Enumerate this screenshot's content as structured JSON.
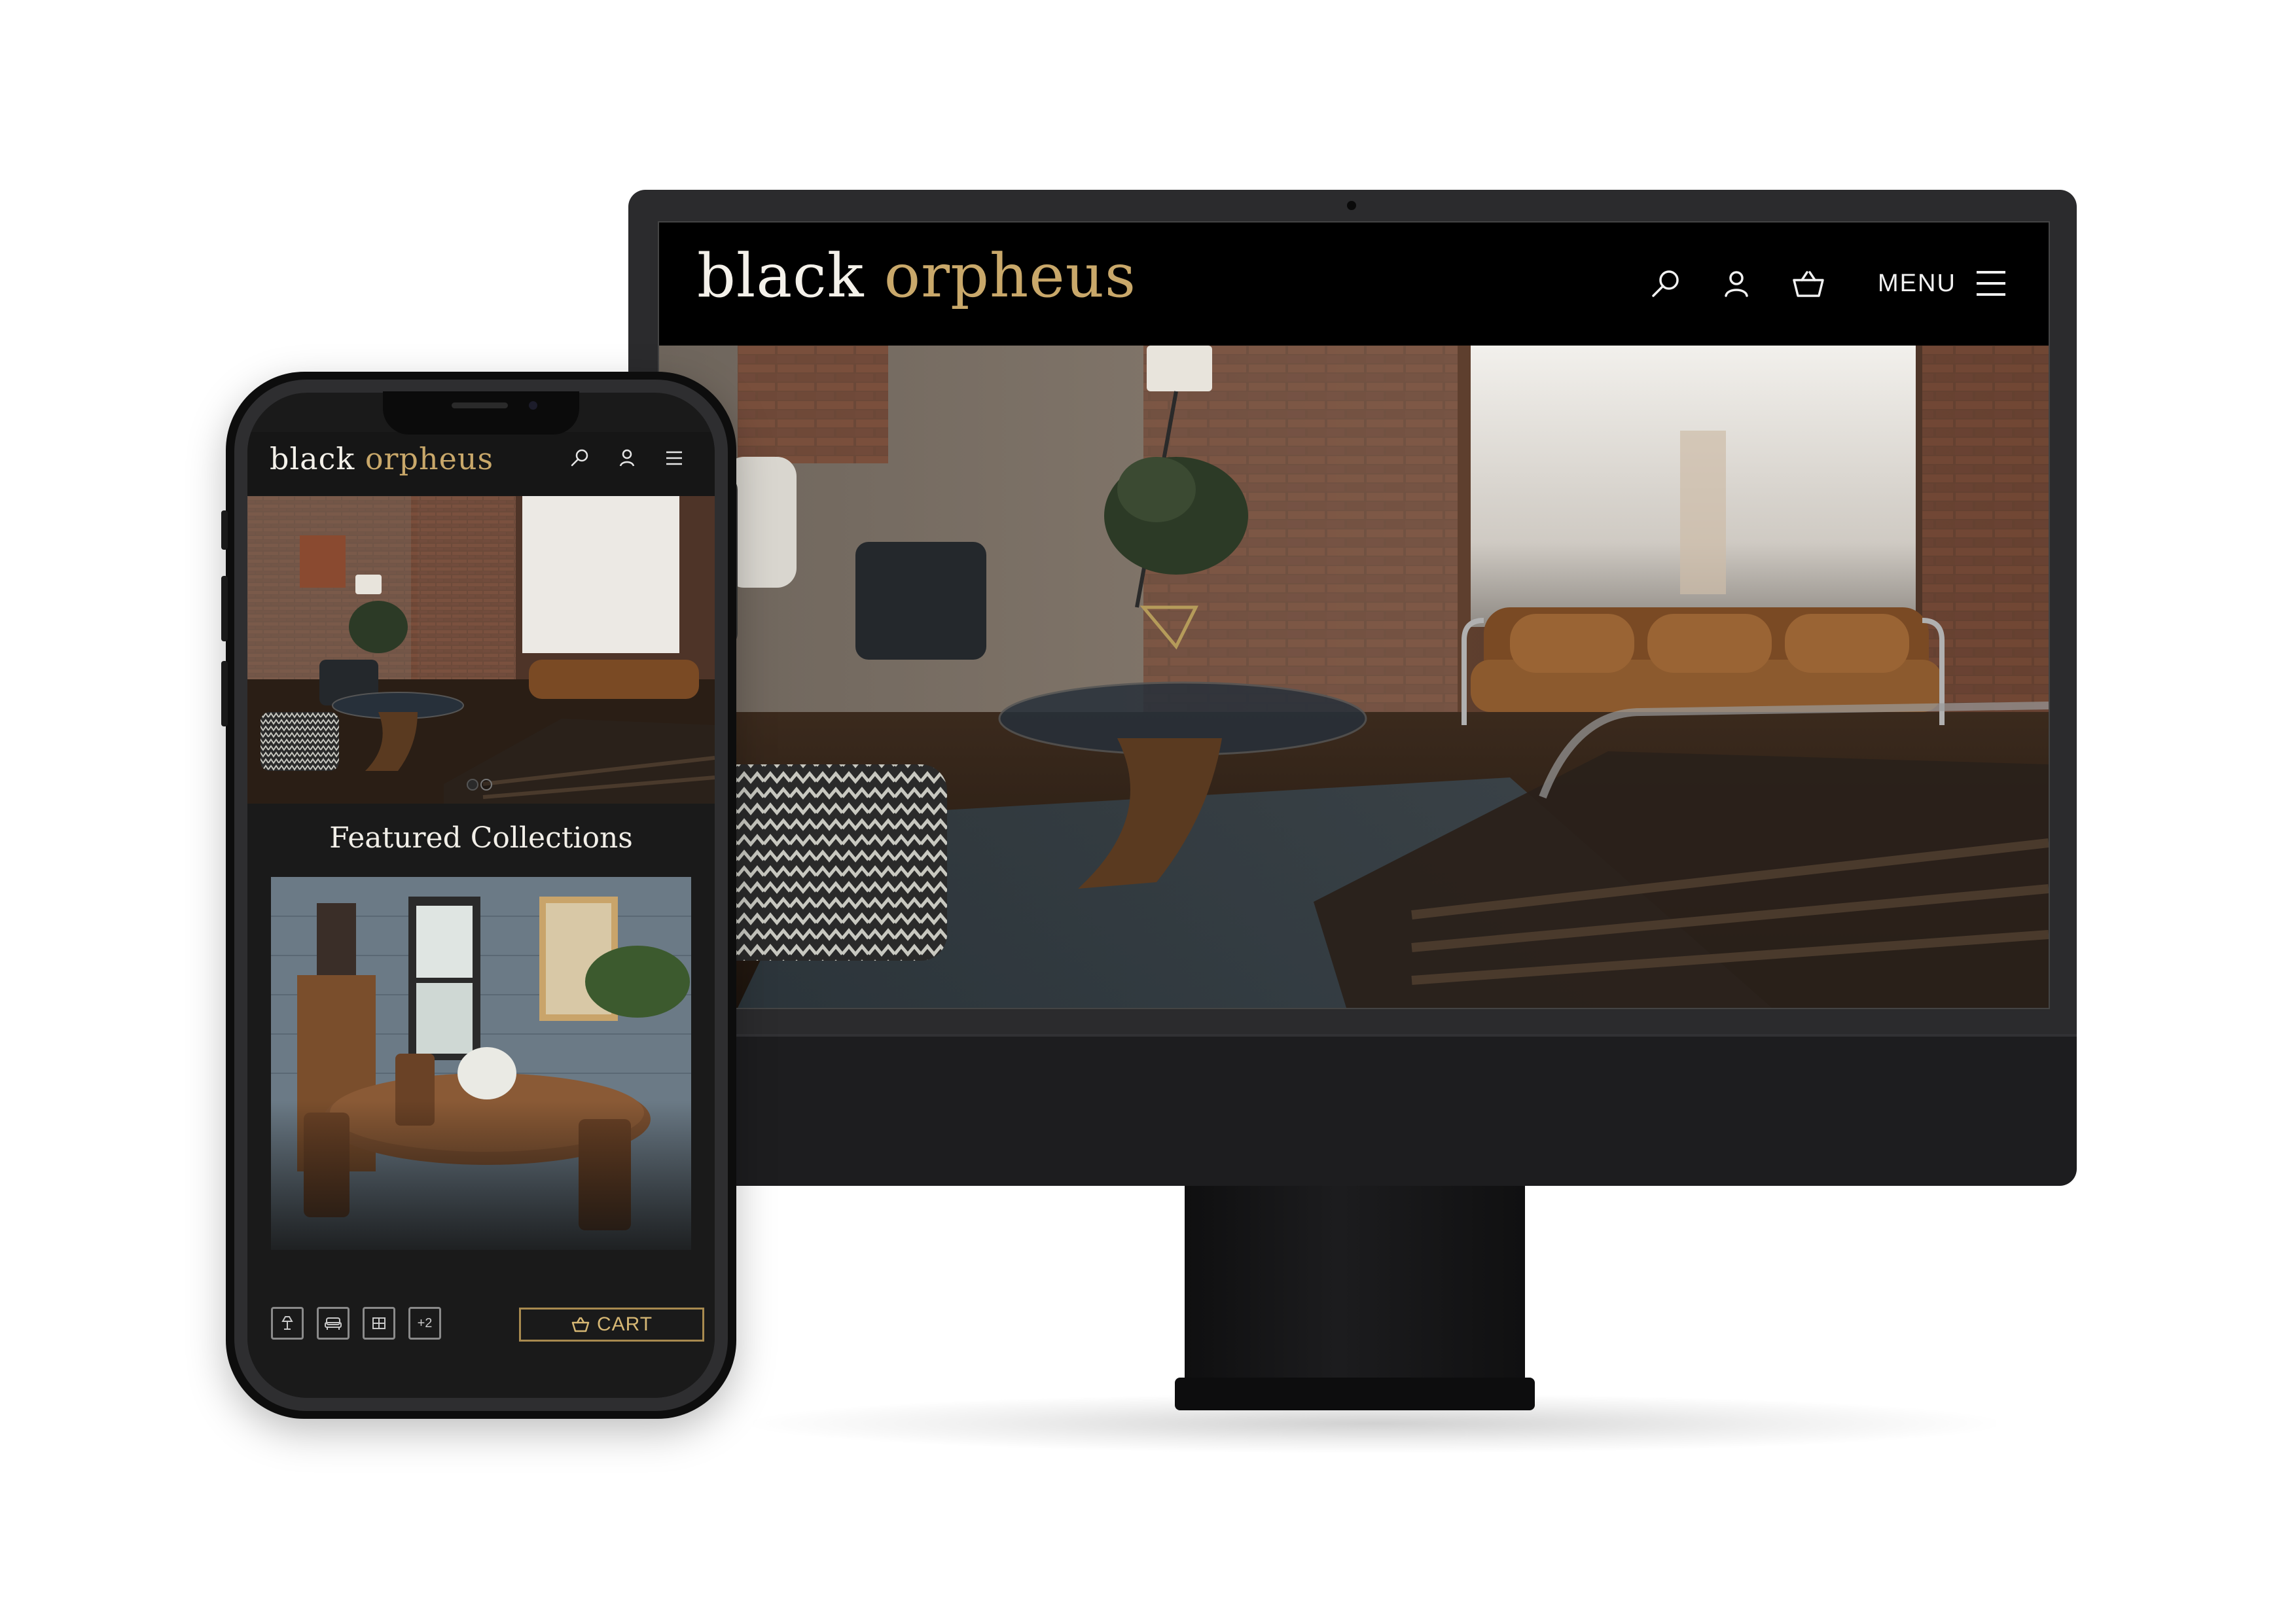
{
  "brand": {
    "name_part1": "black",
    "name_part2": "orpheus",
    "colors": {
      "primary": "#f4f1ea",
      "accent": "#c9a86a",
      "background": "#000000"
    }
  },
  "desktop": {
    "header": {
      "menu_label": "MENU",
      "icons": [
        "search-icon",
        "user-icon",
        "basket-icon",
        "hamburger-icon"
      ]
    },
    "hero": {
      "slide_count": 2,
      "active_slide": 1
    }
  },
  "mobile": {
    "header": {
      "icons": [
        "search-icon",
        "user-icon",
        "hamburger-icon"
      ]
    },
    "hero": {
      "slide_count": 2,
      "active_slide": 1
    },
    "section_title": "Featured Collections",
    "bottom_bar": {
      "categories": [
        "lamp-icon",
        "sofa-icon",
        "cabinet-icon"
      ],
      "more_label": "+2",
      "cart_label": "CART"
    }
  }
}
